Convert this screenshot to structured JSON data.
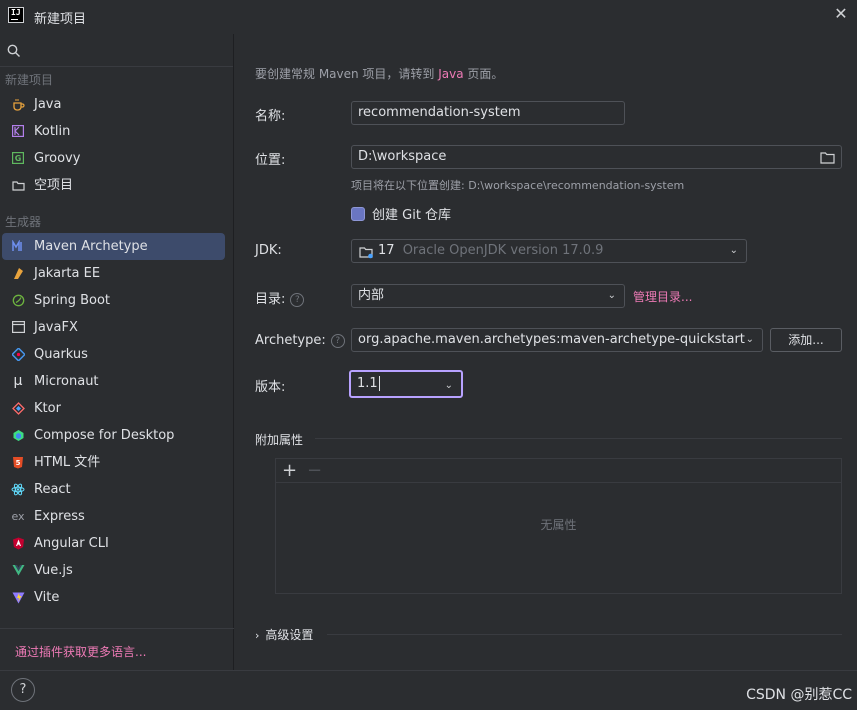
{
  "window": {
    "title": "新建项目",
    "logo": "IJ"
  },
  "sidebar": {
    "section_new": "新建项目",
    "new_items": [
      {
        "label": "Java",
        "icon": "java-cup-icon"
      },
      {
        "label": "Kotlin",
        "icon": "kotlin-icon"
      },
      {
        "label": "Groovy",
        "icon": "groovy-icon"
      },
      {
        "label": "空项目",
        "icon": "empty-project-icon"
      }
    ],
    "section_gen": "生成器",
    "gen_items": [
      {
        "label": "Maven Archetype",
        "icon": "maven-icon"
      },
      {
        "label": "Jakarta EE",
        "icon": "jakarta-icon"
      },
      {
        "label": "Spring Boot",
        "icon": "spring-icon"
      },
      {
        "label": "JavaFX",
        "icon": "javafx-icon"
      },
      {
        "label": "Quarkus",
        "icon": "quarkus-icon"
      },
      {
        "label": "Micronaut",
        "icon": "micronaut-icon"
      },
      {
        "label": "Ktor",
        "icon": "ktor-icon"
      },
      {
        "label": "Compose for Desktop",
        "icon": "compose-icon"
      },
      {
        "label": "HTML 文件",
        "icon": "html5-icon"
      },
      {
        "label": "React",
        "icon": "react-icon"
      },
      {
        "label": "Express",
        "icon": "express-icon"
      },
      {
        "label": "Angular CLI",
        "icon": "angular-icon"
      },
      {
        "label": "Vue.js",
        "icon": "vue-icon"
      },
      {
        "label": "Vite",
        "icon": "vite-icon"
      }
    ],
    "plugin_link": "通过插件获取更多语言..."
  },
  "main": {
    "hint_prefix": "要创建常规 Maven 项目，请转到 ",
    "hint_link": "Java",
    "hint_suffix": " 页面。",
    "name_label": "名称:",
    "name_value": "recommendation-system",
    "location_label": "位置:",
    "location_value": "D:\\workspace",
    "location_hint": "项目将在以下位置创建: D:\\workspace\\recommendation-system",
    "git_label": "创建 Git 仓库",
    "jdk_label": "JDK:",
    "jdk_version": "17",
    "jdk_name": "Oracle OpenJDK version 17.0.9",
    "catalog_label": "目录:",
    "catalog_value": "内部",
    "manage_catalog": "管理目录...",
    "archetype_label": "Archetype:",
    "archetype_value": "org.apache.maven.archetypes:maven-archetype-quickstart",
    "add_button": "添加...",
    "version_label": "版本:",
    "version_value": "1.1",
    "props_title": "附加属性",
    "props_add": "+",
    "props_remove": "−",
    "props_empty": "无属性",
    "advanced_title": "高级设置"
  },
  "bottom": {
    "help": "?",
    "watermark": "CSDN @别惹CC"
  },
  "colors": {
    "accent": "#3d4b6b",
    "link": "#ee7ab6",
    "focus": "#b8a2ff"
  }
}
